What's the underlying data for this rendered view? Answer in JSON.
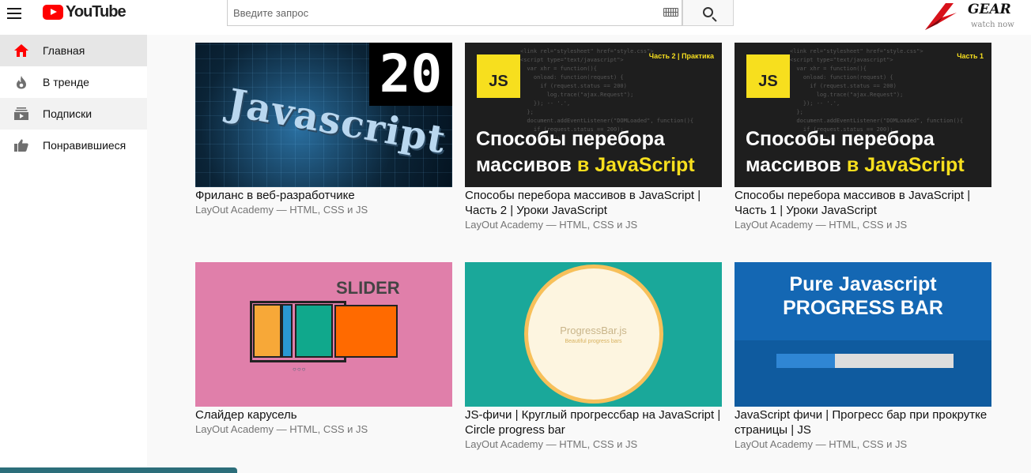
{
  "header": {
    "logo_text": "YouTube",
    "search_placeholder": "Введите запрос",
    "brand_text": "GEAR",
    "brand_sub": "watch now"
  },
  "sidebar": {
    "items": [
      {
        "label": "Главная",
        "icon": "home-icon",
        "active": true
      },
      {
        "label": "В тренде",
        "icon": "fire-icon"
      },
      {
        "label": "Подписки",
        "icon": "subscriptions-icon"
      },
      {
        "label": "Понравившиеся",
        "icon": "thumbs-up-icon"
      }
    ]
  },
  "colors": {
    "accent": "#ff0000",
    "js_yellow": "#f7df1e"
  },
  "videos": [
    {
      "title": "Фриланс в веб-разработчике",
      "channel": "LayOut Academy — HTML, CSS и JS",
      "thumb": {
        "number": "20",
        "word": "Javascript"
      }
    },
    {
      "title": "Способы перебора массивов в JavaScript | Часть 2 | Уроки JavaScript",
      "channel": "LayOut Academy — HTML, CSS и JS",
      "thumb": {
        "badge": "JS",
        "tag": "Часть 2 | Практика",
        "line1": "Способы перебора",
        "line2a": "массивов ",
        "line2b": "в JavaScript"
      }
    },
    {
      "title": "Способы перебора массивов в JavaScript | Часть 1 | Уроки JavaScript",
      "channel": "LayOut Academy — HTML, CSS и JS",
      "thumb": {
        "badge": "JS",
        "tag": "Часть 1",
        "line1": "Способы перебора",
        "line2a": "массивов ",
        "line2b": "в JavaScript"
      }
    },
    {
      "title": "Слайдер карусель",
      "channel": "LayOut Academy — HTML, CSS и JS",
      "thumb": {
        "label": "SLIDER"
      }
    },
    {
      "title": "JS-фичи | Круглый прогрессбар на JavaScript | Circle progress bar",
      "channel": "LayOut Academy — HTML, CSS и JS",
      "thumb": {
        "label": "ProgressBar.js",
        "sub": "Beautiful progress bars"
      }
    },
    {
      "title": "JavaScript фичи | Прогресс бар при прокрутке страницы | JS",
      "channel": "LayOut Academy — HTML, CSS и JS",
      "thumb": {
        "line1": "Pure Javascript",
        "line2": "PROGRESS BAR",
        "progress": 0.33
      }
    }
  ]
}
